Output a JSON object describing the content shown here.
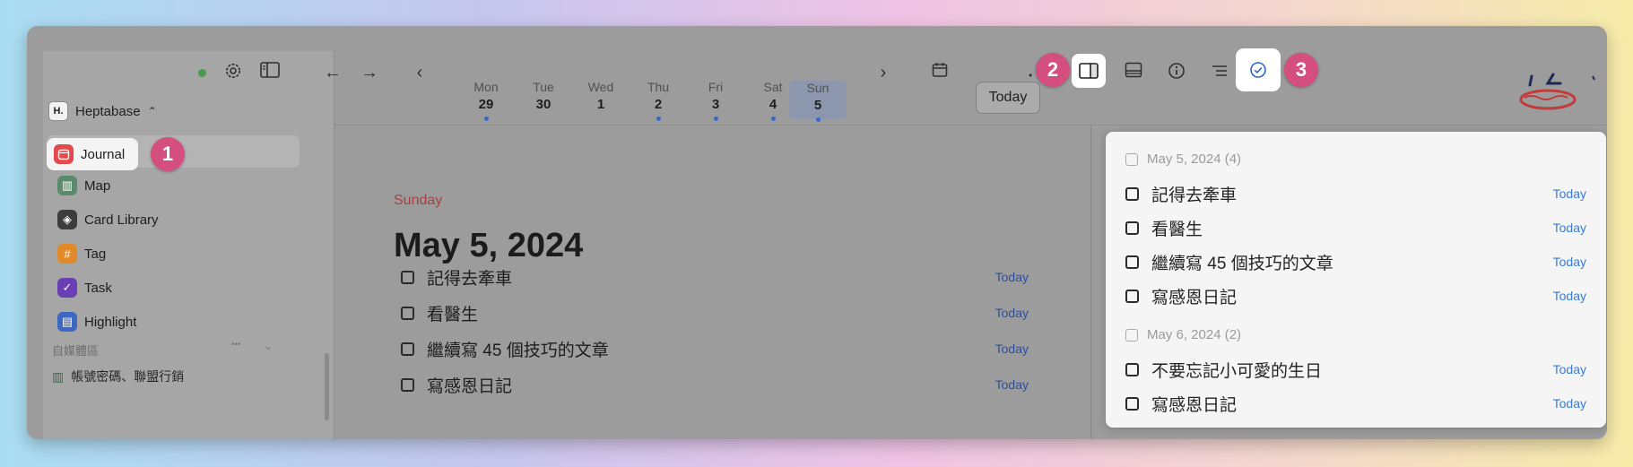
{
  "window": {
    "traffic_colors": [
      "#8a8a8a",
      "#8a8a8a",
      "#8a8a8a"
    ]
  },
  "sidebar": {
    "workspace": "Heptabase",
    "workspace_logo": "H.",
    "nav": [
      {
        "label": "Journal",
        "icon": "journal-icon",
        "color": "#e5484d"
      },
      {
        "label": "Map",
        "icon": "map-icon",
        "color": "#5b8b6d"
      },
      {
        "label": "Card Library",
        "icon": "card-library-icon",
        "color": "#3c3c3c"
      },
      {
        "label": "Tag",
        "icon": "tag-icon",
        "color": "#e08a2a"
      },
      {
        "label": "Task",
        "icon": "task-icon",
        "color": "#6a3fb5"
      },
      {
        "label": "Highlight",
        "icon": "highlight-icon",
        "color": "#3c67c2"
      }
    ],
    "section_title": "自媒體區",
    "section_more": "•••",
    "sub_item": "帳號密碼、聯盟行銷"
  },
  "badges": [
    "1",
    "2",
    "3"
  ],
  "week": {
    "days": [
      {
        "name": "Mon",
        "date": "29",
        "mark": true,
        "active": false
      },
      {
        "name": "Tue",
        "date": "30",
        "mark": false,
        "active": false
      },
      {
        "name": "Wed",
        "date": "1",
        "mark": false,
        "active": false
      },
      {
        "name": "Thu",
        "date": "2",
        "mark": true,
        "active": false
      },
      {
        "name": "Fri",
        "date": "3",
        "mark": true,
        "active": false
      },
      {
        "name": "Sat",
        "date": "4",
        "mark": true,
        "active": false
      },
      {
        "name": "Sun",
        "date": "5",
        "mark": true,
        "active": true
      }
    ],
    "today_label": "Today"
  },
  "main": {
    "weekday": "Sunday",
    "date": "May 5, 2024",
    "tasks": [
      {
        "text": "記得去牽車",
        "when": "Today"
      },
      {
        "text": "看醫生",
        "when": "Today"
      },
      {
        "text": "繼續寫 45 個技巧的文章",
        "when": "Today"
      },
      {
        "text": "寫感恩日記",
        "when": "Today"
      }
    ]
  },
  "panel": {
    "groups": [
      {
        "heading": "May 5, 2024 (4)",
        "tasks": [
          {
            "text": "記得去牽車",
            "when": "Today"
          },
          {
            "text": "看醫生",
            "when": "Today"
          },
          {
            "text": "繼續寫 45 個技巧的文章",
            "when": "Today"
          },
          {
            "text": "寫感恩日記",
            "when": "Today"
          }
        ]
      },
      {
        "heading": "May 6, 2024 (2)",
        "tasks": [
          {
            "text": "不要忘記小可愛的生日",
            "when": "Today"
          },
          {
            "text": "寫感恩日記",
            "when": "Today"
          }
        ]
      }
    ]
  },
  "colors": {
    "accent_badge": "#d44e7e",
    "link_blue": "#3a7bd5",
    "weekday_red": "#a64242"
  }
}
